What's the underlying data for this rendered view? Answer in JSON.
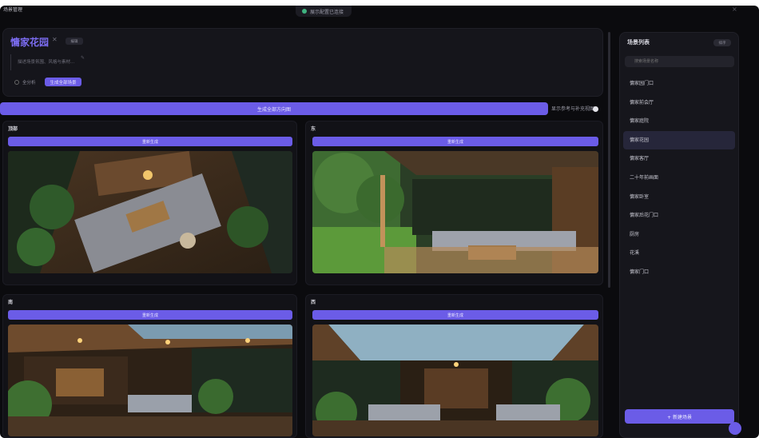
{
  "app": {
    "title": "场景管理",
    "top_status": "展示配置已连接"
  },
  "scene": {
    "title": "慵家花园",
    "badge": "编辑",
    "description_placeholder": "描述场景氛围、风格与素材...",
    "mode_label": "全分析",
    "mode_button": "生成全部场景"
  },
  "toolbar": {
    "generate_all": "生成全部方向图",
    "aux_toggle_label": "显示参考与补充视图"
  },
  "panels": [
    {
      "title": "顶部",
      "button": "重新生成"
    },
    {
      "title": "东",
      "button": "重新生成"
    },
    {
      "title": "南",
      "button": "重新生成"
    },
    {
      "title": "西",
      "button": "重新生成"
    }
  ],
  "sidebar": {
    "title": "场景列表",
    "pill": "排序",
    "search_placeholder": "搜索场景名称",
    "items": [
      {
        "label": "慵家园门口"
      },
      {
        "label": "慵家前会厅"
      },
      {
        "label": "慵家庭院"
      },
      {
        "label": "慵家花园"
      },
      {
        "label": "慵家客厅"
      },
      {
        "label": "二十年前画面"
      },
      {
        "label": "慵家卧室"
      },
      {
        "label": "慵家后花门口"
      },
      {
        "label": "厨房"
      },
      {
        "label": "花溪"
      },
      {
        "label": "慵家门口"
      }
    ],
    "active_index": 3,
    "add_button": "+ 新建场景"
  },
  "colors": {
    "accent": "#6b5ce7",
    "background": "#0b0b0e"
  }
}
